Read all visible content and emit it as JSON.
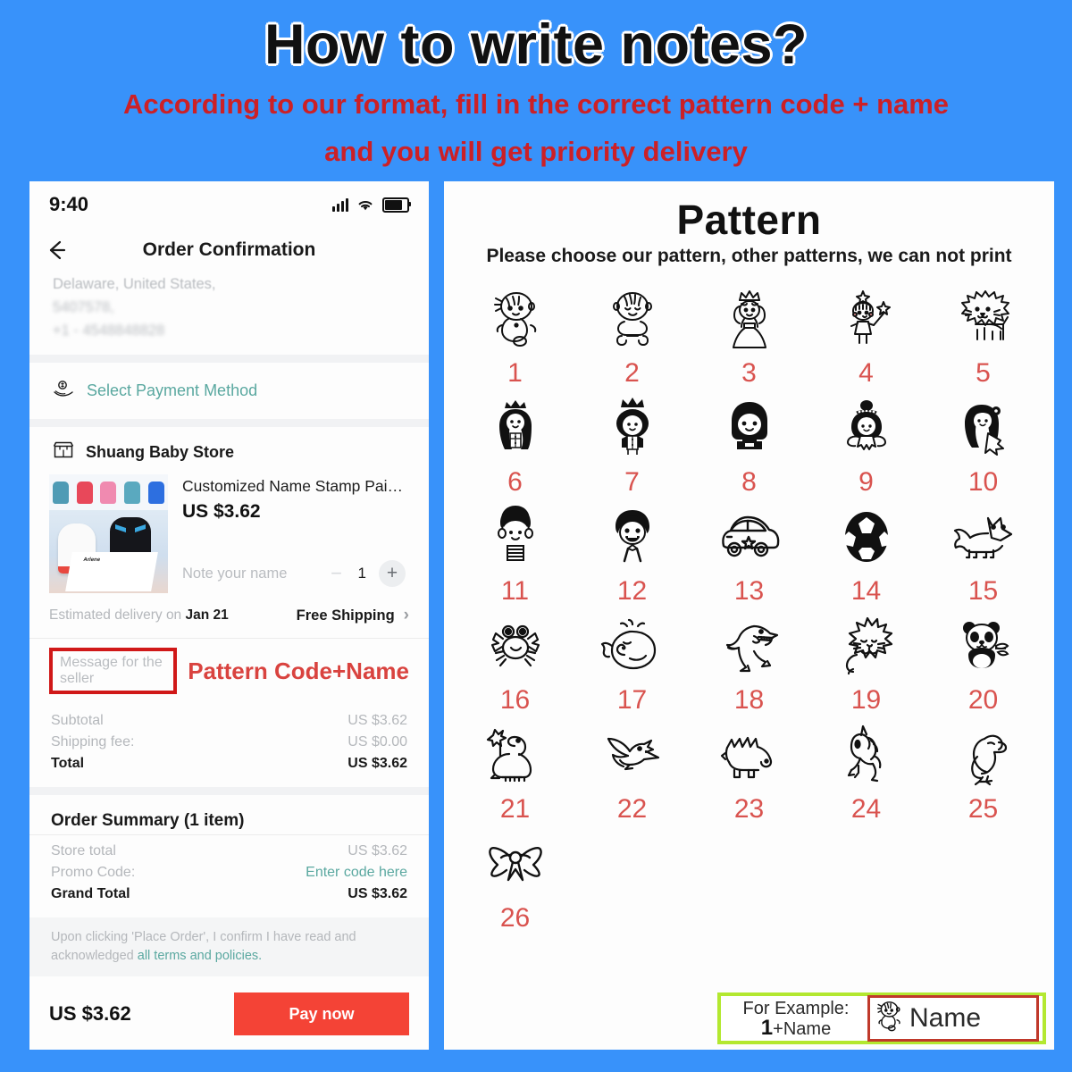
{
  "header": {
    "title": "How to write notes?",
    "subtitle_line1": "According to our format, fill in the correct pattern code + name",
    "subtitle_line2": "and you will get priority delivery",
    "title_color": "#111111",
    "subtitle_color": "#cc2026",
    "background_color": "#3892fa"
  },
  "phone": {
    "status_bar": {
      "time": "9:40"
    },
    "nav": {
      "title": "Order Confirmation",
      "back_icon": "back-arrow-icon"
    },
    "address": {
      "line1": "Delaware, United States,",
      "line2": "5407578,",
      "line3": "+1 - 4548848828"
    },
    "payment": {
      "label": "Select Payment Method",
      "icon": "payment-hand-icon",
      "color": "#5aa8a0"
    },
    "store": {
      "name": "Shuang Baby Store",
      "icon": "store-icon"
    },
    "product": {
      "title": "Customized Name Stamp Paints Perso...",
      "price": "US $3.62",
      "note_placeholder": "Note your name",
      "quantity": "1",
      "minus_label": "−",
      "plus_label": "+",
      "thumbnail_brand": "Arlene"
    },
    "delivery": {
      "estimate_prefix": "Estimated delivery on ",
      "estimate_date": "Jan 21",
      "shipping": "Free Shipping",
      "chevron": "›"
    },
    "message": {
      "placeholder": "Message for the seller",
      "hint": "Pattern Code+Name",
      "box_border_color": "#d01818",
      "hint_color": "#d9433f"
    },
    "totals": [
      {
        "label": "Subtotal",
        "value": "US $3.62",
        "bold": false
      },
      {
        "label": "Shipping fee:",
        "value": "US $0.00",
        "bold": false
      },
      {
        "label": "Total",
        "value": "US $3.62",
        "bold": true
      }
    ],
    "summary_title": "Order Summary (1 item)",
    "summary_rows": [
      {
        "label": "Store total",
        "value": "US $3.62",
        "bold": false,
        "link": false
      },
      {
        "label": "Promo Code:",
        "value": "Enter code here",
        "bold": false,
        "link": true
      },
      {
        "label": "Grand Total",
        "value": "US $3.62",
        "bold": true,
        "link": false
      }
    ],
    "terms": {
      "text": "Upon clicking 'Place Order', I confirm I have read and acknowledged ",
      "link": "all terms and policies."
    },
    "pay_bar": {
      "total": "US $3.62",
      "button": "Pay now",
      "button_color": "#f44336"
    }
  },
  "pattern": {
    "title": "Pattern",
    "subtitle": "Please choose our pattern, other patterns, we can not print",
    "number_color": "#d9534f",
    "items": [
      {
        "num": "1",
        "icon": "baby-girl-icon"
      },
      {
        "num": "2",
        "icon": "baby-boy-icon"
      },
      {
        "num": "3",
        "icon": "princess-icon"
      },
      {
        "num": "4",
        "icon": "fairy-wand-icon"
      },
      {
        "num": "5",
        "icon": "lion-icon"
      },
      {
        "num": "6",
        "icon": "crowned-girl-icon"
      },
      {
        "num": "7",
        "icon": "crowned-boy-icon"
      },
      {
        "num": "8",
        "icon": "boy-dark-hair-icon"
      },
      {
        "num": "9",
        "icon": "fairy-bun-icon"
      },
      {
        "num": "10",
        "icon": "girl-flower-icon"
      },
      {
        "num": "11",
        "icon": "boy-striped-shirt-icon"
      },
      {
        "num": "12",
        "icon": "boy-laughing-icon"
      },
      {
        "num": "13",
        "icon": "car-star-icon"
      },
      {
        "num": "14",
        "icon": "soccer-ball-icon"
      },
      {
        "num": "15",
        "icon": "fox-icon"
      },
      {
        "num": "16",
        "icon": "crab-icon"
      },
      {
        "num": "17",
        "icon": "whale-icon"
      },
      {
        "num": "18",
        "icon": "t-rex-icon"
      },
      {
        "num": "19",
        "icon": "sleeping-lion-icon"
      },
      {
        "num": "20",
        "icon": "panda-icon"
      },
      {
        "num": "21",
        "icon": "brontosaurus-icon"
      },
      {
        "num": "22",
        "icon": "pterodactyl-icon"
      },
      {
        "num": "23",
        "icon": "stegosaurus-icon"
      },
      {
        "num": "24",
        "icon": "unicorn-icon"
      },
      {
        "num": "25",
        "icon": "parrot-icon"
      },
      {
        "num": "26",
        "icon": "bow-ribbon-icon"
      }
    ],
    "example": {
      "label": "For Example:",
      "code": "1",
      "suffix": "+Name",
      "preview_text": "Name",
      "preview_icon": "baby-girl-icon",
      "outer_border_color": "#b3e830",
      "inner_border_color": "#c0392b"
    }
  }
}
